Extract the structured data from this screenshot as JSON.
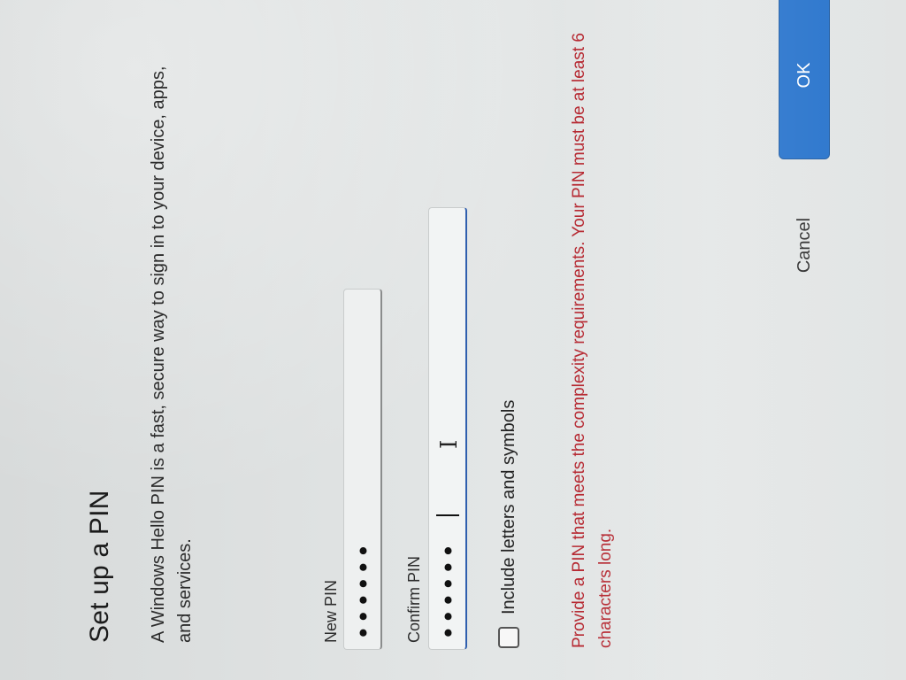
{
  "dialog": {
    "title": "Set up a PIN",
    "description": "A Windows Hello PIN is a fast, secure way to sign in to your device, apps, and services.",
    "new_pin": {
      "label": "New PIN",
      "value_masked": "••••••"
    },
    "confirm_pin": {
      "label": "Confirm PIN",
      "value_masked": "••••••"
    },
    "checkbox": {
      "label": "Include letters and symbols",
      "checked": false
    },
    "error_message": "Provide a PIN that meets the complexity requirements. Your PIN must be at least 6 characters long.",
    "buttons": {
      "cancel_label": "Cancel",
      "ok_label": "OK"
    }
  },
  "colors": {
    "accent": "#1668c8",
    "error": "#b4232c",
    "text": "#1b1b1b",
    "background": "#dfe2e2"
  }
}
